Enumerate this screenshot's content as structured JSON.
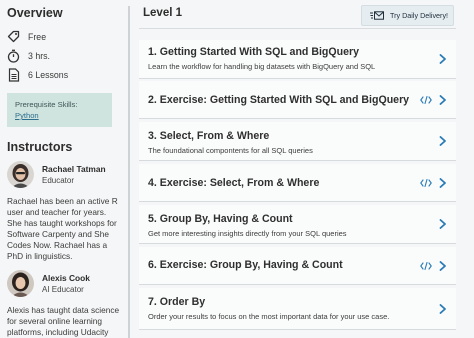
{
  "sidebar": {
    "overview_title": "Overview",
    "meta": [
      {
        "icon": "tag-icon",
        "text": "Free"
      },
      {
        "icon": "stopwatch-icon",
        "text": "3 hrs."
      },
      {
        "icon": "document-icon",
        "text": "6 Lessons"
      }
    ],
    "prereq_label": "Prerequisite Skills:",
    "prereq_link": "Python",
    "instructors_title": "Instructors",
    "instructors": [
      {
        "name": "Rachael Tatman",
        "role": "Educator",
        "bio": "Rachael has been an active R user and teacher for years. She has taught workshops for Software Carpenty and She Codes Now. Rachael has a PhD in linguistics."
      },
      {
        "name": "Alexis Cook",
        "role": "AI Educator",
        "bio": "Alexis has taught data science for several online learning platforms, including Udacity and DataCamp. She holds"
      }
    ]
  },
  "main": {
    "level_title": "Level 1",
    "daily_button": "Try Daily Delivery!",
    "lessons": [
      {
        "title": "1. Getting Started With SQL and BigQuery",
        "desc": "Learn the workflow for handling big datasets with BigQuery and SQL",
        "exercise": false
      },
      {
        "title": "2. Exercise: Getting Started With SQL and BigQuery",
        "desc": "",
        "exercise": true
      },
      {
        "title": "3. Select, From & Where",
        "desc": "The foundational compontents for all SQL queries",
        "exercise": false
      },
      {
        "title": "4. Exercise: Select, From & Where",
        "desc": "",
        "exercise": true
      },
      {
        "title": "5. Group By, Having & Count",
        "desc": "Get more interesting insights directly from your SQL queries",
        "exercise": false
      },
      {
        "title": "6. Exercise: Group By, Having & Count",
        "desc": "",
        "exercise": true
      },
      {
        "title": "7. Order By",
        "desc": "Order your results to focus on the most important data for your use case.",
        "exercise": false
      }
    ]
  },
  "colors": {
    "accent": "#2a7bb6",
    "prereq_bg": "#cfe3df",
    "link": "#2d6f8c"
  }
}
